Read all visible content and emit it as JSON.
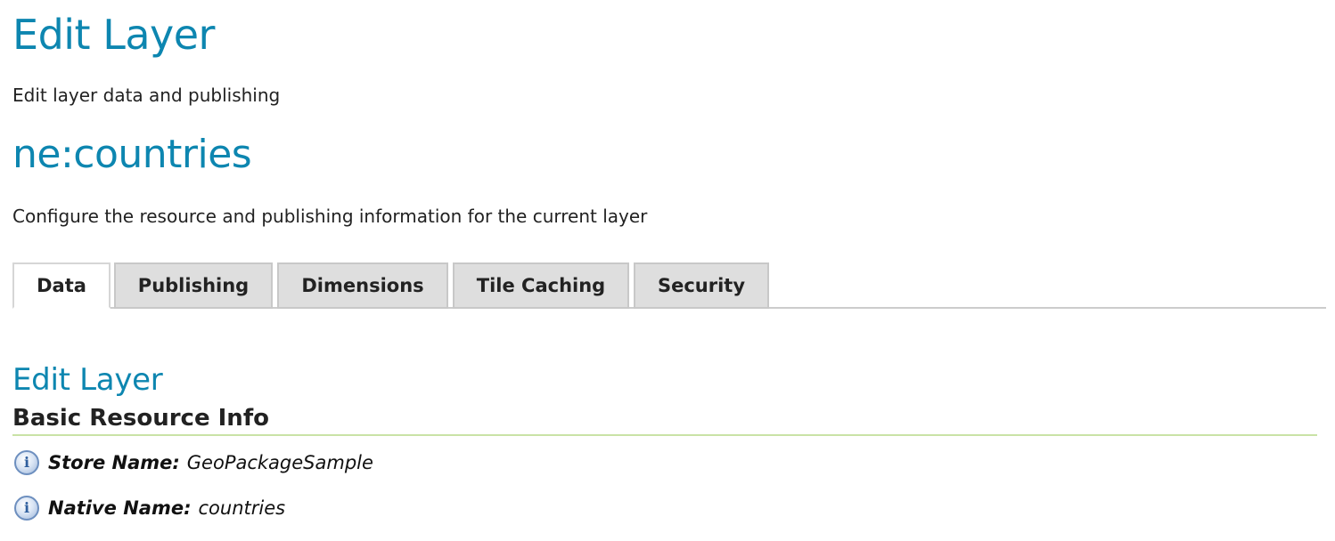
{
  "page": {
    "title": "Edit Layer",
    "description": "Edit layer data and publishing"
  },
  "layer": {
    "name": "ne:countries",
    "description": "Configure the resource and publishing information for the current layer"
  },
  "tabs": [
    {
      "label": "Data",
      "active": true
    },
    {
      "label": "Publishing",
      "active": false
    },
    {
      "label": "Dimensions",
      "active": false
    },
    {
      "label": "Tile Caching",
      "active": false
    },
    {
      "label": "Security",
      "active": false
    }
  ],
  "section": {
    "title": "Edit Layer",
    "subtitle": "Basic Resource Info"
  },
  "info": [
    {
      "label": "Store Name:",
      "value": "GeoPackageSample",
      "icon": "info-icon"
    },
    {
      "label": "Native Name:",
      "value": "countries",
      "icon": "info-icon"
    }
  ],
  "colors": {
    "title_blue": "#0d86b0",
    "divider_green": "#c9e2a6",
    "tab_inactive": "#dedede"
  }
}
